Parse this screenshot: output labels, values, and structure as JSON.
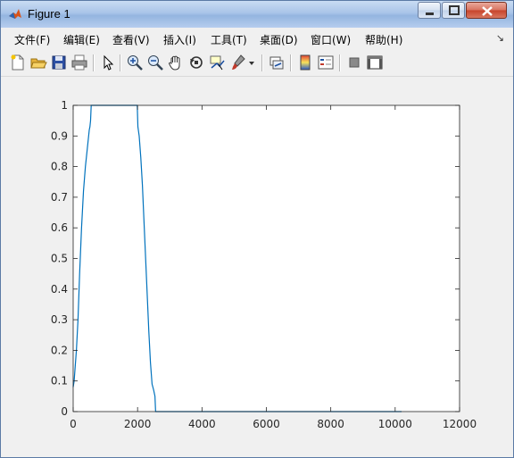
{
  "window": {
    "title": "Figure 1"
  },
  "menu": {
    "items": [
      "文件(F)",
      "编辑(E)",
      "查看(V)",
      "插入(I)",
      "工具(T)",
      "桌面(D)",
      "窗口(W)",
      "帮助(H)"
    ],
    "overflow": "↘"
  },
  "toolbar": {
    "icons": [
      "new-figure-icon",
      "open-file-icon",
      "save-icon",
      "print-icon",
      "pointer-icon",
      "zoom-in-icon",
      "zoom-out-icon",
      "pan-icon",
      "rotate-3d-icon",
      "data-cursor-icon",
      "brush-icon",
      "link-plot-icon",
      "colorbar-icon",
      "legend-icon",
      "hide-plot-tools-icon",
      "show-plot-tools-icon"
    ]
  },
  "chart_data": {
    "type": "line",
    "xlim": [
      0,
      12000
    ],
    "ylim": [
      0,
      1
    ],
    "xticks": [
      0,
      2000,
      4000,
      6000,
      8000,
      10000,
      12000
    ],
    "yticks": [
      0,
      0.1,
      0.2,
      0.3,
      0.4,
      0.5,
      0.6,
      0.7,
      0.8,
      0.9,
      1
    ],
    "xtick_labels": [
      "0",
      "2000",
      "4000",
      "6000",
      "8000",
      "10000",
      "12000"
    ],
    "ytick_labels": [
      "0",
      "0.1",
      "0.2",
      "0.3",
      "0.4",
      "0.5",
      "0.6",
      "0.7",
      "0.8",
      "0.9",
      "1"
    ],
    "grid": false,
    "series": [
      {
        "color": "#0072bd",
        "x": [
          0,
          30,
          100,
          150,
          200,
          260,
          320,
          380,
          440,
          480,
          500,
          520,
          540,
          560,
          600,
          1000,
          1500,
          1990,
          2010,
          2050,
          2100,
          2150,
          2200,
          2250,
          2300,
          2350,
          2400,
          2450,
          2500,
          2540,
          2560,
          2580,
          3000,
          6000,
          9000,
          10200
        ],
        "y": [
          0.08,
          0.1,
          0.2,
          0.3,
          0.45,
          0.6,
          0.72,
          0.8,
          0.86,
          0.9,
          0.92,
          0.93,
          0.95,
          1.0,
          1.0,
          1.0,
          1.0,
          1.0,
          0.93,
          0.9,
          0.83,
          0.74,
          0.62,
          0.5,
          0.38,
          0.26,
          0.16,
          0.09,
          0.07,
          0.05,
          0.0,
          0.0,
          0.0,
          0.0,
          0.0,
          0.0
        ]
      }
    ]
  }
}
